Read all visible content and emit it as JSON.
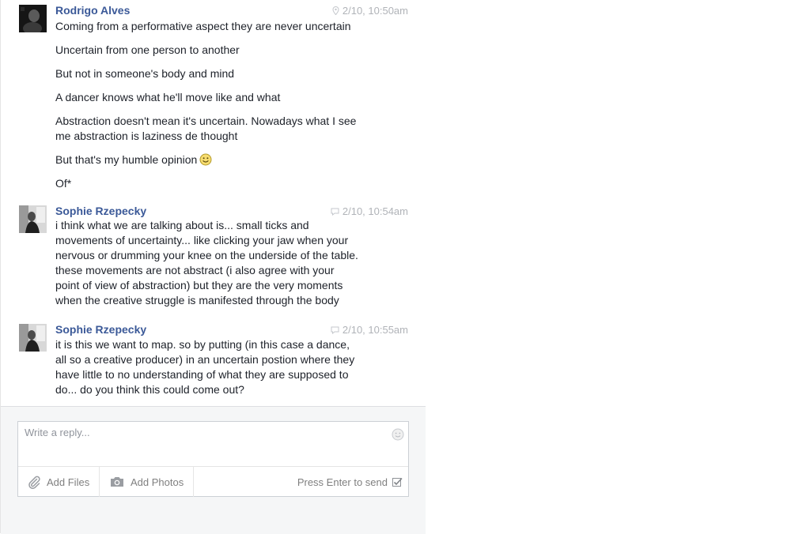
{
  "messages": [
    {
      "sender": "Rodrigo Alves",
      "time": "2/10, 10:50am",
      "status_icon": "location-pin-icon",
      "avatar": "avatar-photo-dark",
      "lines": [
        "Coming from a performative aspect they are never uncertain",
        "Uncertain from one person to another",
        "But not in someone's body and mind",
        "A dancer knows what he'll move like and what",
        "Abstraction doesn't mean it's uncertain. Nowadays what I see",
        "me abstraction is laziness de thought",
        "But that's my humble opinion",
        "Of*"
      ],
      "emoji_after_line": 6
    },
    {
      "sender": "Sophie Rzepecky",
      "time": "2/10, 10:54am",
      "status_icon": "chat-bubble-icon",
      "avatar": "avatar-photo-light",
      "lines": [
        "i think what we are talking about is... small ticks and",
        "movements of uncertainty... like clicking your jaw when your",
        "nervous or drumming your knee on the underside of the table.",
        "these movements are not abstract (i also agree with your",
        "point of view of abstraction) but they are the very moments",
        "when the creative struggle is manifested through the body"
      ]
    },
    {
      "sender": "Sophie Rzepecky",
      "time": "2/10, 10:55am",
      "status_icon": "chat-bubble-icon",
      "avatar": "avatar-photo-light",
      "lines": [
        "it is this we want to map. so by putting (in this case a dance,",
        "all so a creative producer) in an uncertain postion where they",
        "have little to no understanding of what they are supposed to",
        "do... do you think this could come out?"
      ]
    }
  ],
  "composer": {
    "placeholder": "Write a reply...",
    "value": "",
    "add_files_label": "Add Files",
    "add_photos_label": "Add Photos",
    "send_hint": "Press Enter to send",
    "press_enter_checked": true
  },
  "colors": {
    "sender_name": "#3b5998",
    "timestamp": "#b0b3b8",
    "body_text": "#1d2129",
    "composer_bg": "#f5f6f7"
  }
}
